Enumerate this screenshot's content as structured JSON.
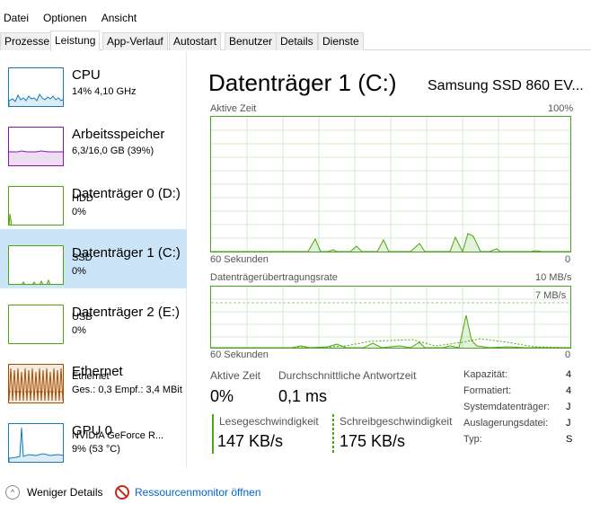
{
  "menu": [
    "Datei",
    "Optionen",
    "Ansicht"
  ],
  "tabs": [
    "Prozesse",
    "Leistung",
    "App-Verlauf",
    "Autostart",
    "Benutzer",
    "Details",
    "Dienste"
  ],
  "active_tab": "Leistung",
  "sidebar": [
    {
      "title": "CPU",
      "lines": [
        "14%  4,10 GHz"
      ],
      "color": "#117dbb",
      "icon": "cpu-graph-icon"
    },
    {
      "title": "Arbeitsspeicher",
      "lines": [
        "6,3/16,0 GB (39%)"
      ],
      "color": "#8b12ae",
      "icon": "memory-graph-icon"
    },
    {
      "title": "Datenträger 0 (D:)",
      "lines": [
        "HDD",
        "0%"
      ],
      "color": "#4da60c",
      "icon": "disk-graph-icon"
    },
    {
      "title": "Datenträger 1 (C:)",
      "lines": [
        "SSD",
        "0%"
      ],
      "color": "#4da60c",
      "icon": "disk-graph-icon",
      "selected": true
    },
    {
      "title": "Datenträger 2 (E:)",
      "lines": [
        "USB",
        "0%"
      ],
      "color": "#4da60c",
      "icon": "disk-graph-icon"
    },
    {
      "title": "Ethernet",
      "lines": [
        "Ethernet",
        "Ges.: 0,3  Empf.: 3,4 MBit"
      ],
      "color": "#a74f01",
      "icon": "network-graph-icon"
    },
    {
      "title": "GPU 0",
      "lines": [
        "NVIDIA GeForce R...",
        "9%  (53 °C)"
      ],
      "color": "#117dbb",
      "icon": "gpu-graph-icon"
    }
  ],
  "main": {
    "title": "Datenträger 1 (C:)",
    "model": "Samsung SSD 860 EV...",
    "graph1": {
      "label": "Aktive Zeit",
      "max": "100%",
      "time": "60 Sekunden",
      "min": "0"
    },
    "graph2": {
      "label": "Datenträgerübertragungsrate",
      "max": "10 MB/s",
      "inner_max": "7 MB/s",
      "time": "60 Sekunden",
      "min": "0"
    },
    "stats": {
      "active_label": "Aktive Zeit",
      "active_value": "0%",
      "resp_label": "Durchschnittliche Antwortzeit",
      "resp_value": "0,1 ms",
      "read_label": "Lesegeschwindigkeit",
      "read_value": "147 KB/s",
      "write_label": "Schreibgeschwindigkeit",
      "write_value": "175 KB/s"
    },
    "properties": [
      {
        "label": "Kapazität:",
        "value": "4"
      },
      {
        "label": "Formatiert:",
        "value": "4"
      },
      {
        "label": "Systemdatenträger:",
        "value": "J"
      },
      {
        "label": "Auslagerungsdatei:",
        "value": "J"
      },
      {
        "label": "Typ:",
        "value": "S"
      }
    ]
  },
  "footer": {
    "less_details": "Weniger Details",
    "resource_monitor": "Ressourcenmonitor öffnen"
  }
}
